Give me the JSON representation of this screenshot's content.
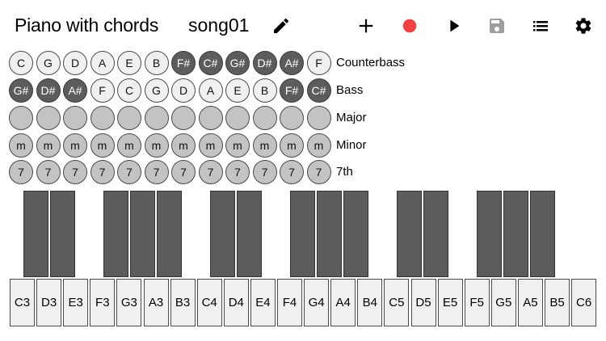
{
  "header": {
    "title": "Piano with chords",
    "song_name": "song01",
    "icons": [
      "pencil-icon",
      "plus-icon",
      "record-icon",
      "play-icon",
      "save-icon",
      "list-icon",
      "gear-icon"
    ],
    "colors": {
      "record": "#f04040",
      "save_disabled": "#9e9e9e",
      "icon": "#000000"
    }
  },
  "rows": [
    {
      "label": "Counterbass",
      "id": "counterbass",
      "buttons": [
        {
          "t": "C",
          "s": "light"
        },
        {
          "t": "G",
          "s": "light"
        },
        {
          "t": "D",
          "s": "light"
        },
        {
          "t": "A",
          "s": "light"
        },
        {
          "t": "E",
          "s": "light"
        },
        {
          "t": "B",
          "s": "light"
        },
        {
          "t": "F#",
          "s": "dark"
        },
        {
          "t": "C#",
          "s": "dark"
        },
        {
          "t": "G#",
          "s": "dark"
        },
        {
          "t": "D#",
          "s": "dark"
        },
        {
          "t": "A#",
          "s": "dark"
        },
        {
          "t": "F",
          "s": "light"
        }
      ]
    },
    {
      "label": "Bass",
      "id": "bass",
      "buttons": [
        {
          "t": "G#",
          "s": "dark"
        },
        {
          "t": "D#",
          "s": "dark"
        },
        {
          "t": "A#",
          "s": "dark"
        },
        {
          "t": "F",
          "s": "light"
        },
        {
          "t": "C",
          "s": "light"
        },
        {
          "t": "G",
          "s": "light"
        },
        {
          "t": "D",
          "s": "light"
        },
        {
          "t": "A",
          "s": "light"
        },
        {
          "t": "E",
          "s": "light"
        },
        {
          "t": "B",
          "s": "light"
        },
        {
          "t": "F#",
          "s": "dark"
        },
        {
          "t": "C#",
          "s": "dark"
        }
      ]
    },
    {
      "label": "Major",
      "id": "major",
      "buttons": [
        {
          "t": "",
          "s": "mid"
        },
        {
          "t": "",
          "s": "mid"
        },
        {
          "t": "",
          "s": "mid"
        },
        {
          "t": "",
          "s": "mid"
        },
        {
          "t": "",
          "s": "mid"
        },
        {
          "t": "",
          "s": "mid"
        },
        {
          "t": "",
          "s": "mid"
        },
        {
          "t": "",
          "s": "mid"
        },
        {
          "t": "",
          "s": "mid"
        },
        {
          "t": "",
          "s": "mid"
        },
        {
          "t": "",
          "s": "mid"
        },
        {
          "t": "",
          "s": "mid"
        }
      ]
    },
    {
      "label": "Minor",
      "id": "minor",
      "buttons": [
        {
          "t": "m",
          "s": "mid"
        },
        {
          "t": "m",
          "s": "mid"
        },
        {
          "t": "m",
          "s": "mid"
        },
        {
          "t": "m",
          "s": "mid"
        },
        {
          "t": "m",
          "s": "mid"
        },
        {
          "t": "m",
          "s": "mid"
        },
        {
          "t": "m",
          "s": "mid"
        },
        {
          "t": "m",
          "s": "mid"
        },
        {
          "t": "m",
          "s": "mid"
        },
        {
          "t": "m",
          "s": "mid"
        },
        {
          "t": "m",
          "s": "mid"
        },
        {
          "t": "m",
          "s": "mid"
        }
      ]
    },
    {
      "label": "7th",
      "id": "seventh",
      "buttons": [
        {
          "t": "7",
          "s": "mid"
        },
        {
          "t": "7",
          "s": "mid"
        },
        {
          "t": "7",
          "s": "mid"
        },
        {
          "t": "7",
          "s": "mid"
        },
        {
          "t": "7",
          "s": "mid"
        },
        {
          "t": "7",
          "s": "mid"
        },
        {
          "t": "7",
          "s": "mid"
        },
        {
          "t": "7",
          "s": "mid"
        },
        {
          "t": "7",
          "s": "mid"
        },
        {
          "t": "7",
          "s": "mid"
        },
        {
          "t": "7",
          "s": "mid"
        },
        {
          "t": "7",
          "s": "mid"
        }
      ]
    }
  ],
  "piano": {
    "white_keys": [
      "C3",
      "D3",
      "E3",
      "F3",
      "G3",
      "A3",
      "B3",
      "C4",
      "D4",
      "E4",
      "F4",
      "G4",
      "A4",
      "B4",
      "C5",
      "D5",
      "E5",
      "F5",
      "G5",
      "A5",
      "B5",
      "C6"
    ],
    "black_keys": [
      "C#3",
      "D#3",
      "F#3",
      "G#3",
      "A#3",
      "C#4",
      "D#4",
      "F#4",
      "G#4",
      "A#4",
      "C#5",
      "D#5",
      "F#5",
      "G#5",
      "A#5"
    ],
    "colors": {
      "white": "#f0f0f0",
      "black": "#5c5c5c"
    }
  }
}
